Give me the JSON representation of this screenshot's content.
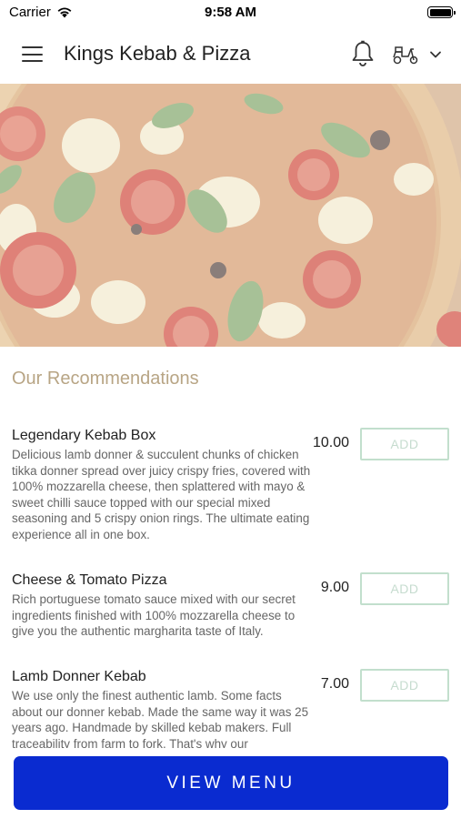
{
  "status_bar": {
    "carrier": "Carrier",
    "time": "9:58 AM",
    "battery_level": 1.0
  },
  "header": {
    "title": "Kings Kebab & Pizza",
    "icons": [
      "menu-icon",
      "bell-icon",
      "scooter-icon",
      "chevron-down-icon"
    ]
  },
  "hero": {
    "image": "pizza-photo"
  },
  "recommendations": {
    "title": "Our Recommendations",
    "items": [
      {
        "name": "Legendary Kebab Box",
        "description": "Delicious lamb donner & succulent chunks of chicken tikka donner spread over juicy crispy fries, covered with 100% mozzarella cheese, then splattered with mayo & sweet chilli sauce topped with our special mixed seasoning and 5 crispy onion rings. The ultimate eating experience all in one box.",
        "price": "10.00",
        "add_label": "ADD"
      },
      {
        "name": "Cheese & Tomato Pizza",
        "description": "Rich portuguese tomato sauce mixed with our secret ingredients finished with 100% mozzarella cheese to give you the authentic margharita taste of Italy.",
        "price": "9.00",
        "add_label": "ADD"
      },
      {
        "name": "Lamb Donner Kebab",
        "description": "We use only the finest authentic lamb. Some facts about our donner kebab. Made the same way it was 25 years ago. Handmade by skilled kebab makers. Full traceability from farm to fork. That's why our",
        "price": "7.00",
        "add_label": "ADD"
      }
    ]
  },
  "footer": {
    "view_menu_label": "VIEW MENU"
  },
  "colors": {
    "accent_blue": "#0a2bd0",
    "section_title": "#b8a585",
    "add_border": "#c2dfcd"
  }
}
